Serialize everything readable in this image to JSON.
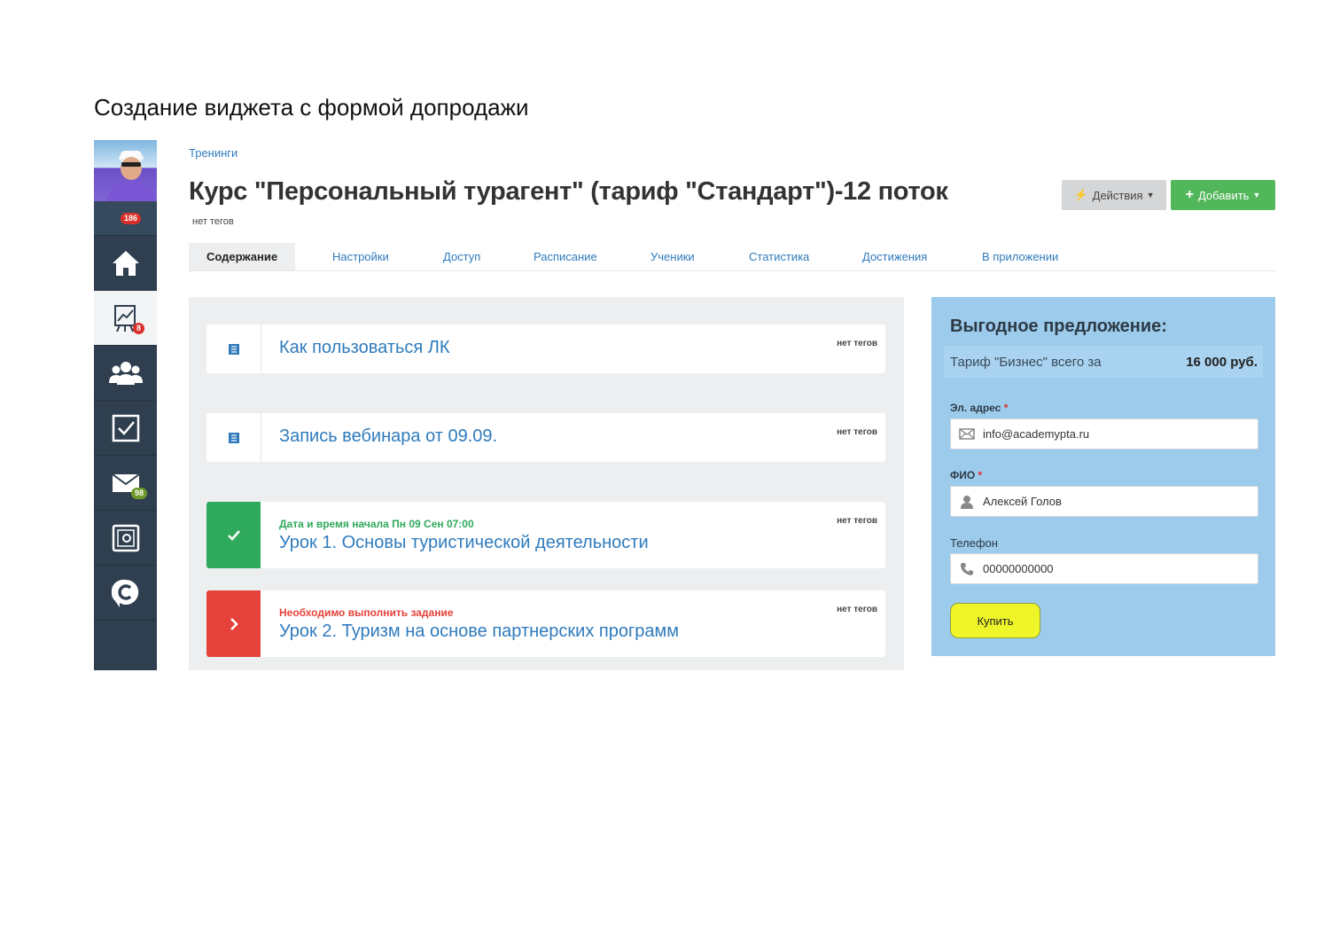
{
  "doc_title": "Создание виджета с формой допродажи",
  "sidebar": {
    "notify_count": "186",
    "items": [
      {
        "icon": "home-icon",
        "badge": ""
      },
      {
        "icon": "chart-icon",
        "badge": "8",
        "active": true
      },
      {
        "icon": "users-icon",
        "badge": ""
      },
      {
        "icon": "checkbox-icon",
        "badge": ""
      },
      {
        "icon": "mail-icon",
        "badge": "98"
      },
      {
        "icon": "safe-icon",
        "badge": ""
      },
      {
        "icon": "chat-icon",
        "badge": ""
      }
    ]
  },
  "breadcrumb": "Тренинги",
  "course_title": "Курс \"Персональный турагент\" (тариф \"Стандарт\")-12 поток",
  "no_tags": "нет тегов",
  "buttons": {
    "actions": "Действия",
    "add": "Добавить"
  },
  "tabs": [
    "Содержание",
    "Настройки",
    "Доступ",
    "Расписание",
    "Ученики",
    "Статистика",
    "Достижения",
    "В приложении"
  ],
  "lessons": [
    {
      "title": "Как пользоваться ЛК",
      "subtitle": "",
      "tags": "нет тегов",
      "status": "doc"
    },
    {
      "title": "Запись вебинара от 09.09.",
      "subtitle": "",
      "tags": "нет тегов",
      "status": "doc"
    },
    {
      "title": "Урок 1. Основы туристической деятельности",
      "subtitle": "Дата и время начала Пн 09 Сен 07:00",
      "tags": "нет тегов",
      "status": "done"
    },
    {
      "title": "Урок 2. Туризм на основе партнерских программ",
      "subtitle": "Необходимо выполнить задание",
      "tags": "нет тегов",
      "status": "todo"
    }
  ],
  "offer": {
    "title": "Выгодное предложение:",
    "price_label": "Тариф \"Бизнес\" всего за",
    "price_value": "16 000 руб.",
    "email_label": "Эл. адрес",
    "email_value": "info@academypta.ru",
    "name_label": "ФИО",
    "name_value": "Алексей Голов",
    "phone_label": "Телефон",
    "phone_value": "00000000000",
    "required_mark": "*",
    "buy_label": "Купить"
  },
  "colors": {
    "sidebar": "#2f3f50",
    "link": "#2f7bbd",
    "add_green": "#52b65a",
    "offer_bg": "#9ccbec",
    "buy_yellow": "#eef528"
  }
}
